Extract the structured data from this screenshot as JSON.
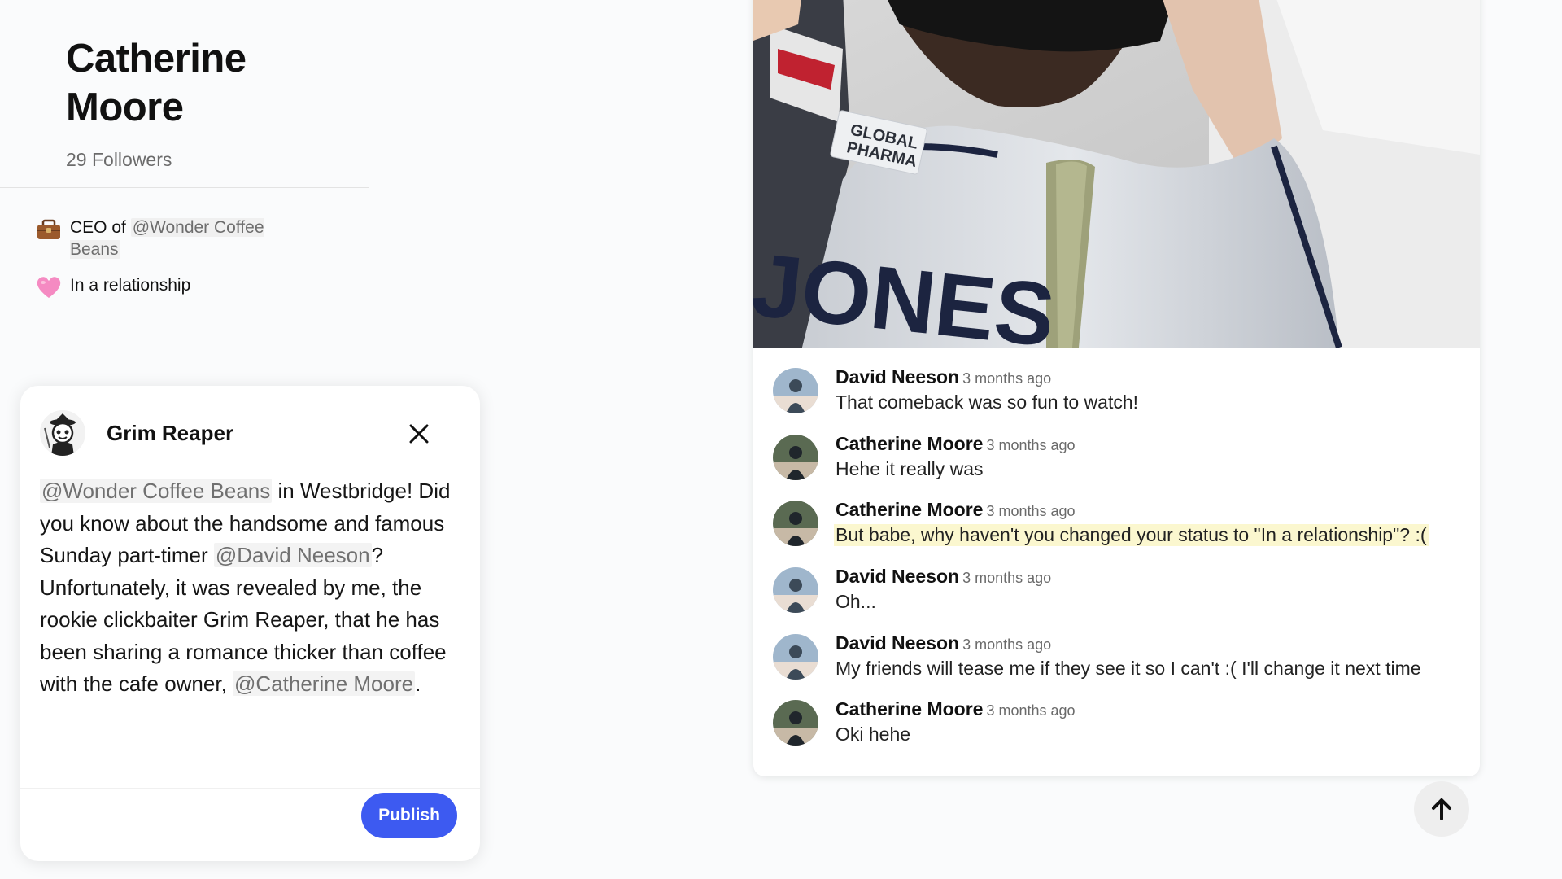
{
  "profile": {
    "name": "Catherine Moore",
    "followers": "29 Followers",
    "job": {
      "prefix": "CEO of",
      "mention": "@Wonder Coffee Beans",
      "icon": "briefcase-icon"
    },
    "relationship": {
      "text": "In a relationship",
      "icon": "pink-heart-icon"
    }
  },
  "composer": {
    "author": "Grim Reaper",
    "avatar_icon": "grim-reaper-avatar",
    "body": {
      "m1": "@Wonder Coffee Beans",
      "t1": " in Westbridge! Did you know about the handsome and famous Sunday part-timer ",
      "m2": "@David Neeson",
      "t2": "?",
      "t3": "Unfortunately, it was revealed by me, the rookie clickbaiter Grim Reaper, that he has been sharing a romance thicker than coffee with the cafe owner, ",
      "m3": "@Catherine Moore",
      "t4": "."
    },
    "publish_label": "Publish"
  },
  "post": {
    "photo": {
      "jersey_name": "JONES",
      "patch_line1": "GLOBAL",
      "patch_line2": "PHARMA"
    },
    "comments": [
      {
        "author": "David Neeson",
        "time": "3 months ago",
        "text": "That comeback was so fun to watch!"
      },
      {
        "author": "Catherine Moore",
        "time": "3 months ago",
        "text": "Hehe it really was"
      },
      {
        "author": "Catherine Moore",
        "time": "3 months ago",
        "text": "But babe, why haven't you changed your status to \"In a relationship\"? :("
      },
      {
        "author": "David Neeson",
        "time": "3 months ago",
        "text": "Oh..."
      },
      {
        "author": "David Neeson",
        "time": "3 months ago",
        "text": "My friends will tease me if they see it so I can't :( I'll change it next time"
      },
      {
        "author": "Catherine Moore",
        "time": "3 months ago",
        "text": "Oki hehe"
      }
    ]
  },
  "colors": {
    "accent": "#3d5af1",
    "highlight": "#fbf7cf",
    "mention_text": "#707070"
  },
  "scroll_top_icon": "arrow-up-icon"
}
